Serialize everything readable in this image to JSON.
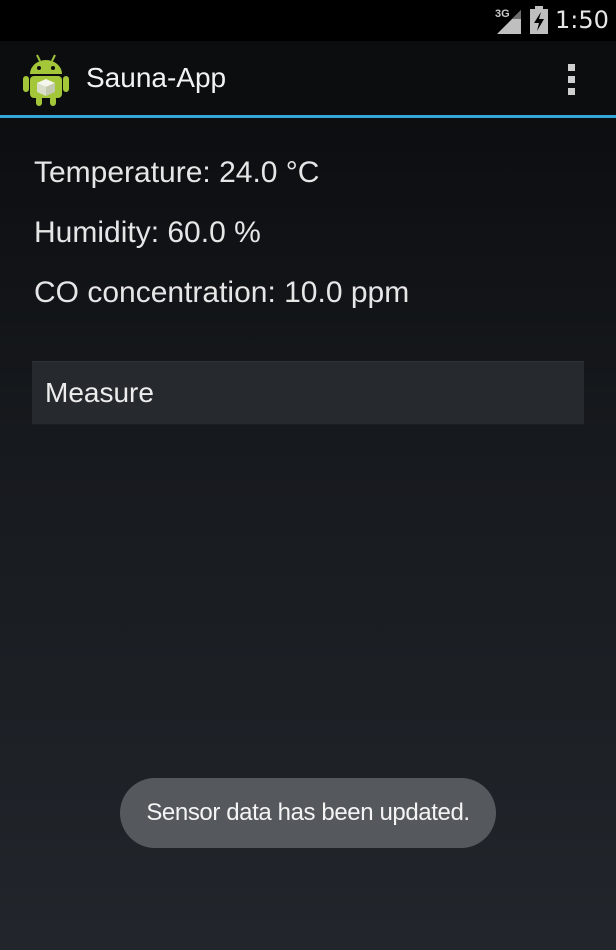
{
  "status_bar": {
    "network_type": "3G",
    "time": "1:50",
    "icons": [
      "signal-icon",
      "battery-charging-icon"
    ]
  },
  "action_bar": {
    "title": "Sauna-App",
    "app_icon": "android-robot-icon",
    "overflow_icon": "overflow-menu-icon",
    "accent_color": "#34a6d8"
  },
  "readings": {
    "temperature": "Temperature: 24.0 °C",
    "humidity": "Humidity: 60.0 %",
    "co": "CO concentration: 10.0 ppm"
  },
  "measure_button": {
    "label": "Measure"
  },
  "toast": {
    "message": "Sensor data has been updated."
  }
}
